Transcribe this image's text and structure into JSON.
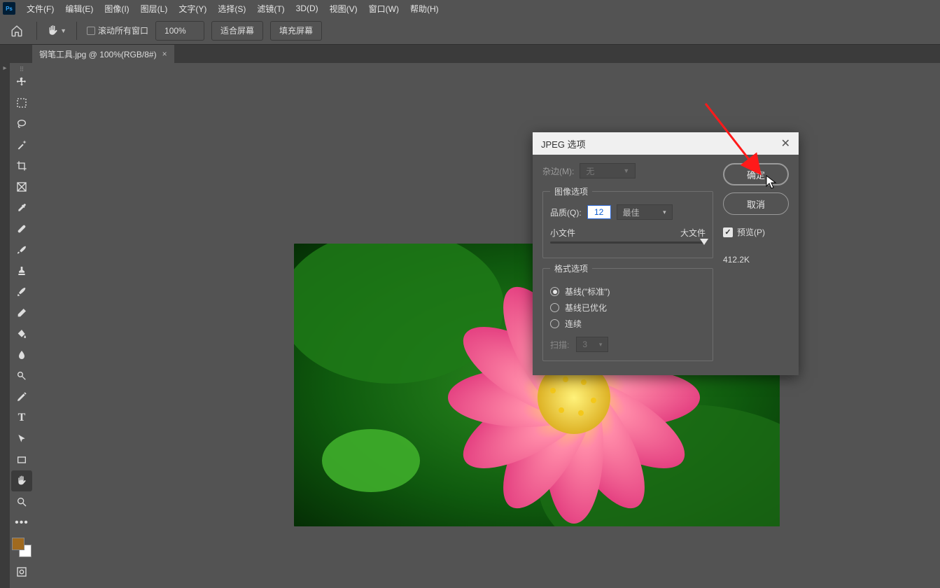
{
  "menu": {
    "items": [
      "文件(F)",
      "编辑(E)",
      "图像(I)",
      "图层(L)",
      "文字(Y)",
      "选择(S)",
      "滤镜(T)",
      "3D(D)",
      "视图(V)",
      "窗口(W)",
      "帮助(H)"
    ]
  },
  "options": {
    "scroll_all": "滚动所有窗口",
    "zoom": "100%",
    "fit_screen": "适合屏幕",
    "fill_screen": "填充屏幕"
  },
  "tab": {
    "label": "钢笔工具.jpg @ 100%(RGB/8#)",
    "close": "×"
  },
  "dialog": {
    "title": "JPEG 选项",
    "matte_label": "杂边(M):",
    "matte_value": "无",
    "ok": "确定",
    "cancel": "取消",
    "preview_label": "预览(P)",
    "filesize": "412.2K",
    "img_opts_legend": "图像选项",
    "quality_label": "品质(Q):",
    "quality_value": "12",
    "quality_preset": "最佳",
    "small_file": "小文件",
    "large_file": "大文件",
    "fmt_legend": "格式选项",
    "fmt_baseline": "基线(\"标准\")",
    "fmt_optimized": "基线已优化",
    "fmt_progressive": "连续",
    "scan_label": "扫描:",
    "scan_value": "3"
  }
}
